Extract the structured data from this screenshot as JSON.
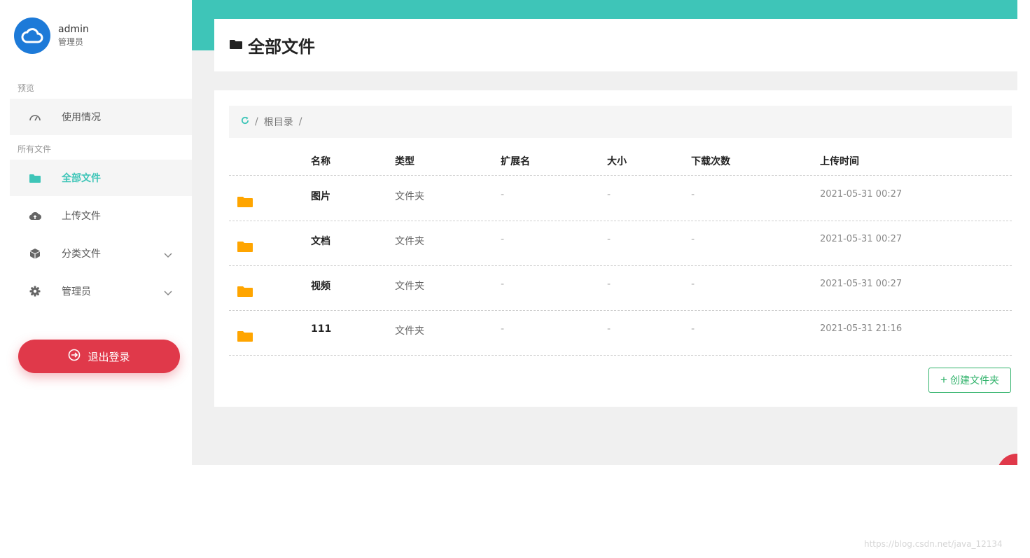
{
  "user": {
    "name": "admin",
    "role": "管理员"
  },
  "sidebar": {
    "section_preview": "预览",
    "section_files": "所有文件",
    "items": [
      {
        "label": "使用情况",
        "icon": "gauge-icon"
      },
      {
        "label": "全部文件",
        "icon": "folder-icon",
        "active": true
      },
      {
        "label": "上传文件",
        "icon": "cloud-upload-icon"
      },
      {
        "label": "分类文件",
        "icon": "cube-icon",
        "expandable": true
      },
      {
        "label": "管理员",
        "icon": "gear-icon",
        "expandable": true
      }
    ],
    "logout_label": "退出登录"
  },
  "page": {
    "title": "全部文件"
  },
  "breadcrumb": {
    "separator": "/",
    "root": "根目录"
  },
  "table": {
    "columns": [
      "名称",
      "类型",
      "扩展名",
      "大小",
      "下载次数",
      "上传时间"
    ],
    "rows": [
      {
        "name": "图片",
        "type": "文件夹",
        "ext": "-",
        "size": "-",
        "downloads": "-",
        "time": "2021-05-31 00:27"
      },
      {
        "name": "文档",
        "type": "文件夹",
        "ext": "-",
        "size": "-",
        "downloads": "-",
        "time": "2021-05-31 00:27"
      },
      {
        "name": "视频",
        "type": "文件夹",
        "ext": "-",
        "size": "-",
        "downloads": "-",
        "time": "2021-05-31 00:27"
      },
      {
        "name": "111",
        "type": "文件夹",
        "ext": "-",
        "size": "-",
        "downloads": "-",
        "time": "2021-05-31 21:16"
      }
    ]
  },
  "create_folder": {
    "plus": "+",
    "label": "创建文件夹"
  },
  "watermark": "https://blog.csdn.net/java_12134",
  "colors": {
    "accent": "#3ec5b8",
    "danger": "#e0394a",
    "folder": "#ffa500",
    "success": "#2fb26a"
  }
}
